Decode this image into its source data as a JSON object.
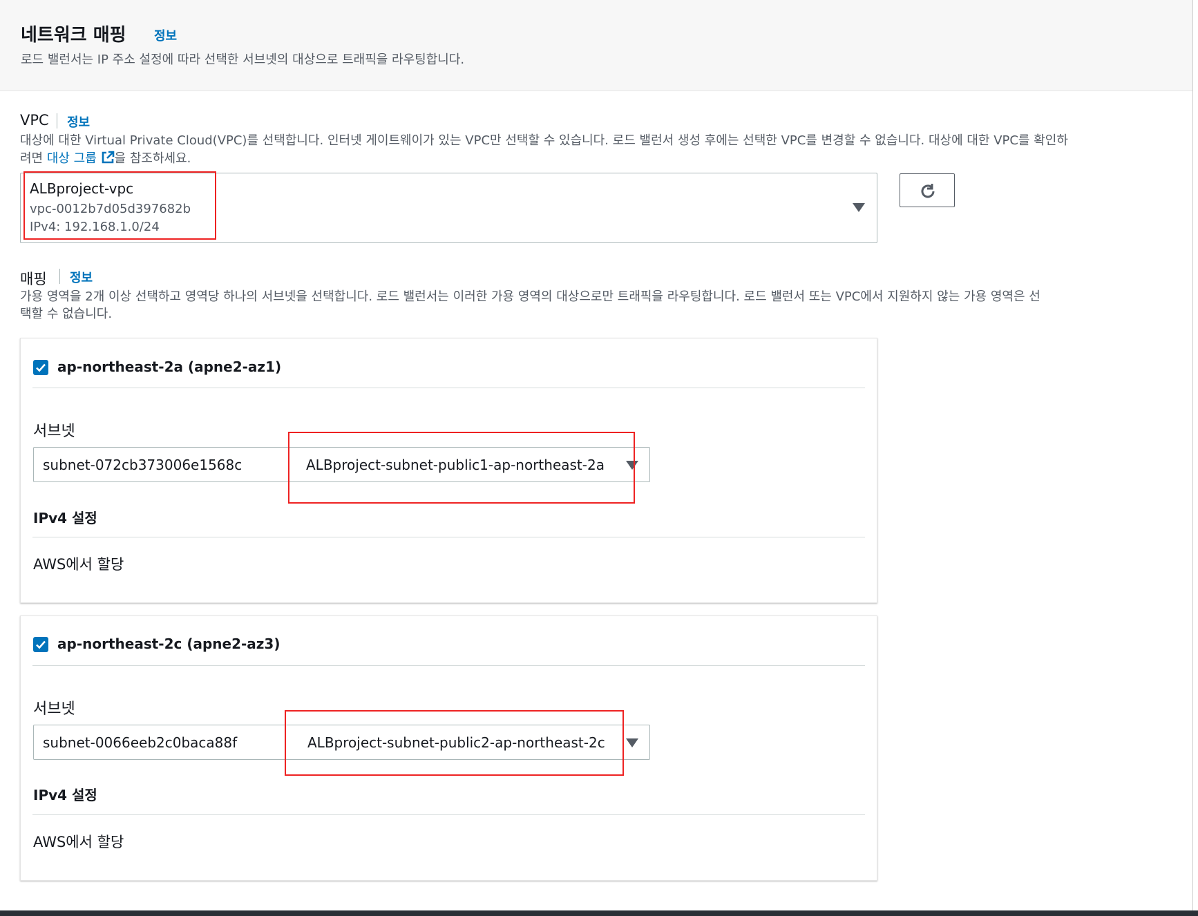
{
  "section": {
    "title": "네트워크 매핑",
    "info": "정보",
    "description": "로드 밸런서는 IP 주소 설정에 따라 선택한 서브넷의 대상으로 트래픽을 라우팅합니다."
  },
  "vpc": {
    "label": "VPC",
    "info": "정보",
    "description_line1": "대상에 대한 Virtual Private Cloud(VPC)를 선택합니다. 인터넷 게이트웨이가 있는 VPC만 선택할 수 있습니다. 로드 밸런서 생성 후에는 선택한 VPC를 변경할 수 없습니다. 대상에 대한 VPC를 확인하",
    "description_line2_prefix": "려면 ",
    "description_link": "대상 그룹",
    "description_line2_suffix": "을 참조하세요.",
    "selected_name": "ALBproject-vpc",
    "selected_id": "vpc-0012b7d05d397682b",
    "selected_cidr": "IPv4: 192.168.1.0/24",
    "refresh_icon": "refresh-icon"
  },
  "mapping": {
    "label": "매핑",
    "info": "정보",
    "description_line1": "가용 영역을 2개 이상 선택하고 영역당 하나의 서브넷을 선택합니다. 로드 밸런서는 이러한 가용 영역의 대상으로만 트래픽을 라우팅합니다. 로드 밸런서 또는 VPC에서 지원하지 않는 가용 영역은 선",
    "description_line2": "택할 수 없습니다.",
    "zones": [
      {
        "name": "ap-northeast-2a (apne2-az1)",
        "checked": true,
        "subnet_label": "서브넷",
        "subnet_id": "subnet-072cb373006e1568c",
        "subnet_name": "ALBproject-subnet-public1-ap-northeast-2a",
        "ipv4_label": "IPv4 설정",
        "ipv4_value": "AWS에서 할당"
      },
      {
        "name": "ap-northeast-2c (apne2-az3)",
        "checked": true,
        "subnet_label": "서브넷",
        "subnet_id": "subnet-0066eeb2c0baca88f",
        "subnet_name": "ALBproject-subnet-public2-ap-northeast-2c",
        "ipv4_label": "IPv4 설정",
        "ipv4_value": "AWS에서 할당"
      }
    ]
  },
  "colors": {
    "link": "#0073bb",
    "checkbox": "#0073bb",
    "highlight": "#ee2222"
  }
}
